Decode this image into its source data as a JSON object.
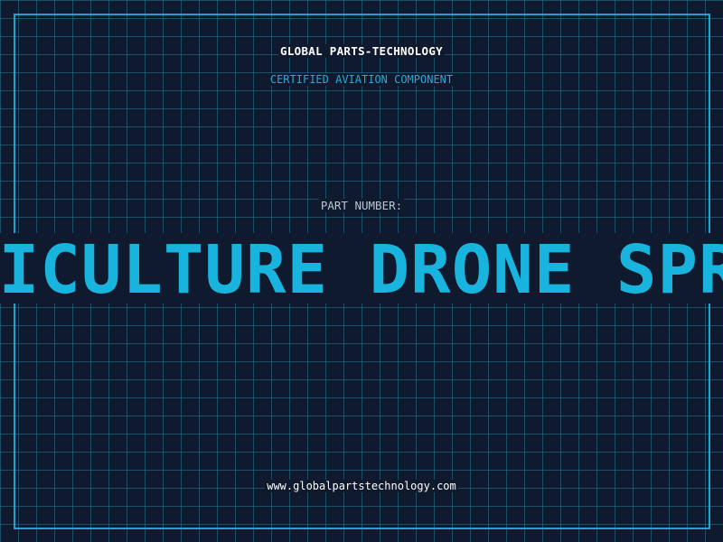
{
  "header": {
    "company": "GLOBAL PARTS-TECHNOLOGY",
    "tagline": "CERTIFIED AVIATION COMPONENT"
  },
  "part": {
    "label": "PART NUMBER:",
    "value": "AGRICULTURE DRONE SPRAYER"
  },
  "footer": {
    "website": "www.globalpartstechnology.com"
  },
  "colors": {
    "background": "#0f1a2e",
    "grid": "#287896",
    "frame": "#1fa3cc",
    "accent": "#18b4dd",
    "text": "#ffffff"
  }
}
